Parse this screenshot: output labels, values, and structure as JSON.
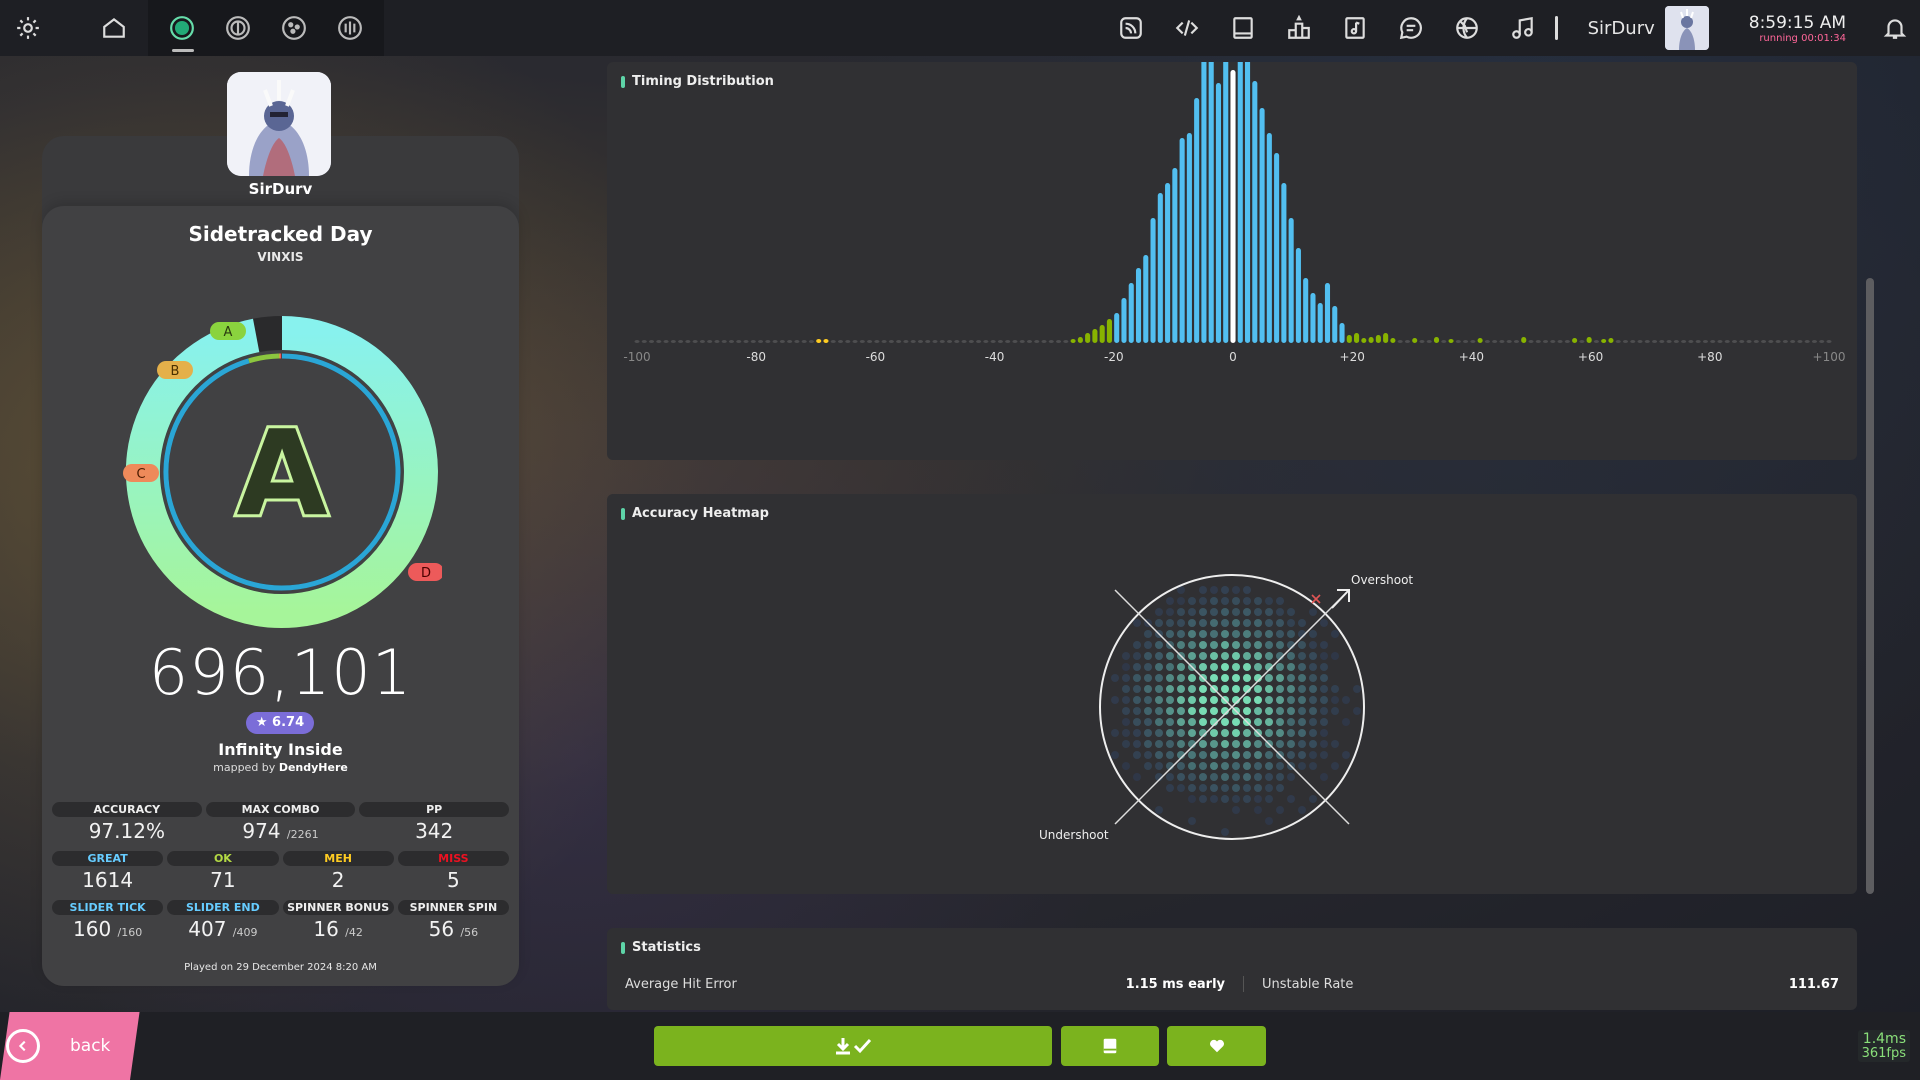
{
  "toolbar": {
    "username": "SirDurv",
    "clock": "8:59:15 AM",
    "running": "running 00:01:34",
    "icons_left": [
      "settings-icon",
      "home-icon"
    ],
    "rulesets": [
      "osu-ruleset-icon",
      "taiko-ruleset-icon",
      "catch-ruleset-icon",
      "mania-ruleset-icon"
    ],
    "icons_right": [
      "rss-icon",
      "code-icon",
      "wiki-icon",
      "ranking-icon",
      "beatmap-listing-icon",
      "chat-icon",
      "dashboard-globe-icon",
      "music-icon"
    ]
  },
  "user_panel": {
    "username": "SirDurv"
  },
  "score": {
    "song_title": "Sidetracked Day",
    "artist": "VINXIS",
    "rank": "A",
    "rank_badges": [
      "A",
      "B",
      "C",
      "D"
    ],
    "total_score": "696,101",
    "star_rating": "★ 6.74",
    "difficulty": "Infinity Inside",
    "mapped_by_prefix": "mapped by",
    "mapper": "DendyHere",
    "accuracy_fraction": 0.9712,
    "stats_top": [
      {
        "label": "ACCURACY",
        "value": "97.12%",
        "max": ""
      },
      {
        "label": "MAX COMBO",
        "value": "974",
        "max": "/2261"
      },
      {
        "label": "PP",
        "value": "342",
        "max": ""
      }
    ],
    "stats_judgements": [
      {
        "label": "GREAT",
        "value": "1614",
        "color": "#66ccff"
      },
      {
        "label": "OK",
        "value": "71",
        "color": "#b3d944"
      },
      {
        "label": "MEH",
        "value": "2",
        "color": "#ffcc22"
      },
      {
        "label": "MISS",
        "value": "5",
        "color": "#ed1121"
      }
    ],
    "stats_extra": [
      {
        "label": "SLIDER TICK",
        "value": "160",
        "max": "/160"
      },
      {
        "label": "SLIDER END",
        "value": "407",
        "max": "/409"
      },
      {
        "label": "SPINNER BONUS",
        "value": "16",
        "max": "/42"
      },
      {
        "label": "SPINNER SPIN",
        "value": "56",
        "max": "/56"
      }
    ],
    "played_on": "Played on 29 December 2024 8:20 AM"
  },
  "timing": {
    "title": "Timing Distribution",
    "tick_labels": [
      "-100",
      "-80",
      "-60",
      "-40",
      "-20",
      "0",
      "+20",
      "+40",
      "+60",
      "+80",
      "+100"
    ]
  },
  "heatmap": {
    "title": "Accuracy Heatmap",
    "overshoot": "Overshoot",
    "undershoot": "Undershoot"
  },
  "statistics": {
    "title": "Statistics",
    "avg_hit_error_label": "Average Hit Error",
    "avg_hit_error_value": "1.15 ms early",
    "unstable_rate_label": "Unstable Rate",
    "unstable_rate_value": "111.67"
  },
  "footer": {
    "back_label": "back",
    "fps_ms": "1.4ms",
    "fps": "361fps"
  },
  "colors": {
    "great": "#66ccff",
    "ok": "#88b300",
    "accent": "#7bb31e",
    "back": "#ef74a4"
  }
}
